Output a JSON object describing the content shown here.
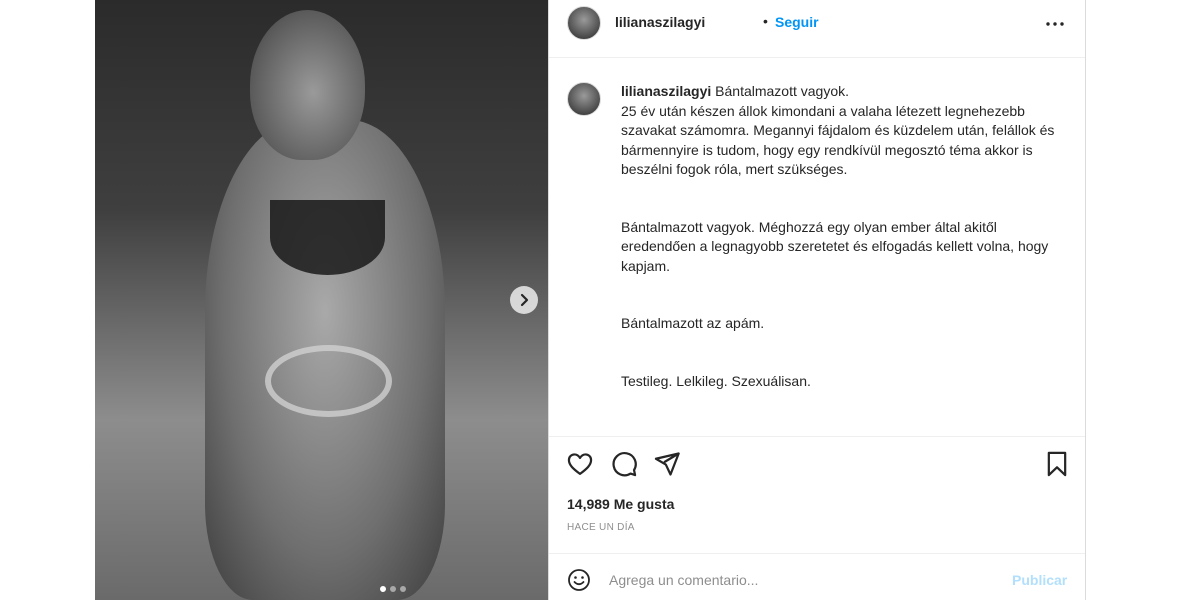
{
  "post": {
    "username": "lilianaszilagyi",
    "separator": "•",
    "follow_label": "Seguir",
    "more_icon": "more-horizontal-icon",
    "image_count": 3,
    "active_image_index": 0
  },
  "caption": {
    "username": "lilianaszilagyi",
    "lines": [
      "Bántalmazott vagyok.",
      "25 év után készen állok kimondani a valaha létezett legnehezebb szavakat számomra. Megannyi fájdalom és küzdelem után, felállok és bármennyire is tudom, hogy egy rendkívül megosztó téma akkor is beszélni fogok róla, mert szükséges.",
      "Bántalmazott vagyok. Méghozzá egy olyan ember által akitől eredendően a legnagyobb szeretetet és elfogadás kellett volna, hogy kapjam.",
      "Bántalmazott az apám.",
      "Testileg. Lelkileg. Szexuálisan."
    ]
  },
  "actions": {
    "like_icon": "heart-icon",
    "comment_icon": "comment-icon",
    "share_icon": "send-icon",
    "save_icon": "bookmark-icon"
  },
  "stats": {
    "likes": "14,989 Me gusta",
    "time": "HACE UN DÍA"
  },
  "comment": {
    "emoji_icon": "emoji-icon",
    "placeholder": "Agrega un comentario...",
    "publish_label": "Publicar"
  },
  "colors": {
    "accent": "#0095f6",
    "publish_disabled": "#b2dffc",
    "muted": "#8e8e8e",
    "text": "#262626",
    "border": "#dbdbdb"
  }
}
